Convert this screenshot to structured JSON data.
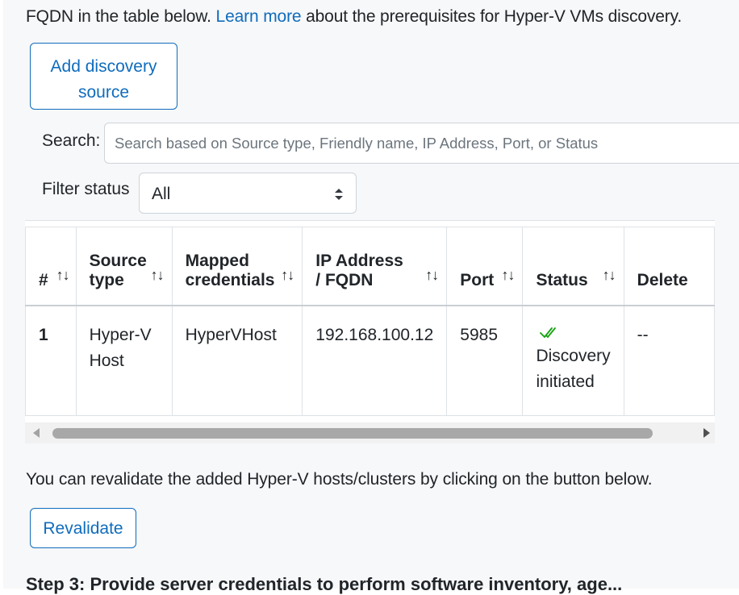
{
  "intro": {
    "prefix": "FQDN in the table below. ",
    "link": "Learn more",
    "suffix": " about the prerequisites for Hyper-V VMs discovery."
  },
  "add_button": {
    "line1": "Add discovery",
    "line2": "source"
  },
  "search": {
    "label": "Search:",
    "placeholder": "Search based on Source type, Friendly name, IP Address, Port, or Status"
  },
  "filter": {
    "label": "Filter status",
    "selected": "All"
  },
  "table": {
    "columns": [
      {
        "line1": "#",
        "line2": ""
      },
      {
        "line1": "Source",
        "line2": "type"
      },
      {
        "line1": "Mapped",
        "line2": "credentials"
      },
      {
        "line1": "IP Address",
        "line2": "/ FQDN"
      },
      {
        "line1": "Port",
        "line2": ""
      },
      {
        "line1": "Status",
        "line2": ""
      },
      {
        "line1": "Delete",
        "line2": ""
      }
    ],
    "sort_glyph": "↑↓",
    "rows": [
      {
        "index": "1",
        "source_type_1": "Hyper-V",
        "source_type_2": "Host",
        "credentials": "HyperVHost",
        "ip": "192.168.100.12",
        "port": "5985",
        "status_1": "Discovery",
        "status_2": "initiated",
        "delete": "--"
      }
    ]
  },
  "revalidate": {
    "text": "You can revalidate the added Hyper-V hosts/clusters by clicking on the button below.",
    "button": "Revalidate"
  },
  "next_step": "Step 3: Provide server credentials to perform software inventory, age...",
  "colors": {
    "accent": "#0f6cbd",
    "success": "#13a10e",
    "border": "#dee2e6"
  }
}
